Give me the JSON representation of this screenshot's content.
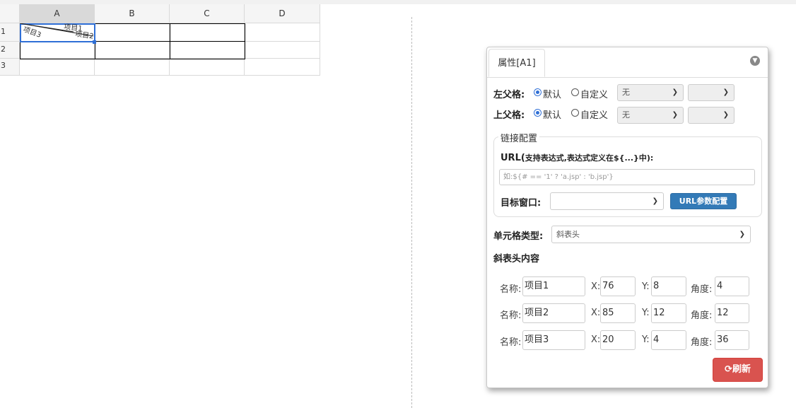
{
  "spreadsheet": {
    "columns": [
      "A",
      "B",
      "C",
      "D"
    ],
    "rows": [
      "1",
      "2",
      "3"
    ],
    "diagonal_header": {
      "labels": [
        "项目1",
        "项目2",
        "项目3"
      ],
      "visible_text": [
        "项目3",
        "项目1",
        "项目2"
      ]
    }
  },
  "panel": {
    "tab_label": "属性[A1]",
    "collapse_icon": "down-arrow-circle-icon",
    "left_parent": {
      "label": "左父格:",
      "option_default": "默认",
      "option_custom": "自定义",
      "selected": "默认",
      "select_value": "无",
      "select2_value": ""
    },
    "top_parent": {
      "label": "上父格:",
      "option_default": "默认",
      "option_custom": "自定义",
      "selected": "默认",
      "select_value": "无",
      "select2_value": ""
    },
    "link_config": {
      "legend": "链接配置",
      "url_label_bold": "URL(",
      "url_label_rest": "支持表达式,表达式定义在${...}中):",
      "url_placeholder": "如:${# == '1' ? 'a.jsp' : 'b.jsp'}",
      "target_label": "目标窗口:",
      "target_value": "",
      "params_button": "URL参数配置"
    },
    "cell_type": {
      "label": "单元格类型:",
      "value": "斜表头"
    },
    "diag_content": {
      "title": "斜表头内容",
      "name_label": "名称:",
      "x_label": "X:",
      "y_label": "Y:",
      "angle_label": "角度:",
      "items": [
        {
          "name": "项目1",
          "x": "76",
          "y": "8",
          "angle": "4"
        },
        {
          "name": "项目2",
          "x": "85",
          "y": "12",
          "angle": "12"
        },
        {
          "name": "项目3",
          "x": "20",
          "y": "4",
          "angle": "36"
        }
      ]
    },
    "refresh_button": "刷新",
    "refresh_icon": "refresh-icon"
  },
  "colors": {
    "selection": "#2f6fd6",
    "primary_button": "#337ab7",
    "danger_button": "#d9534f"
  }
}
